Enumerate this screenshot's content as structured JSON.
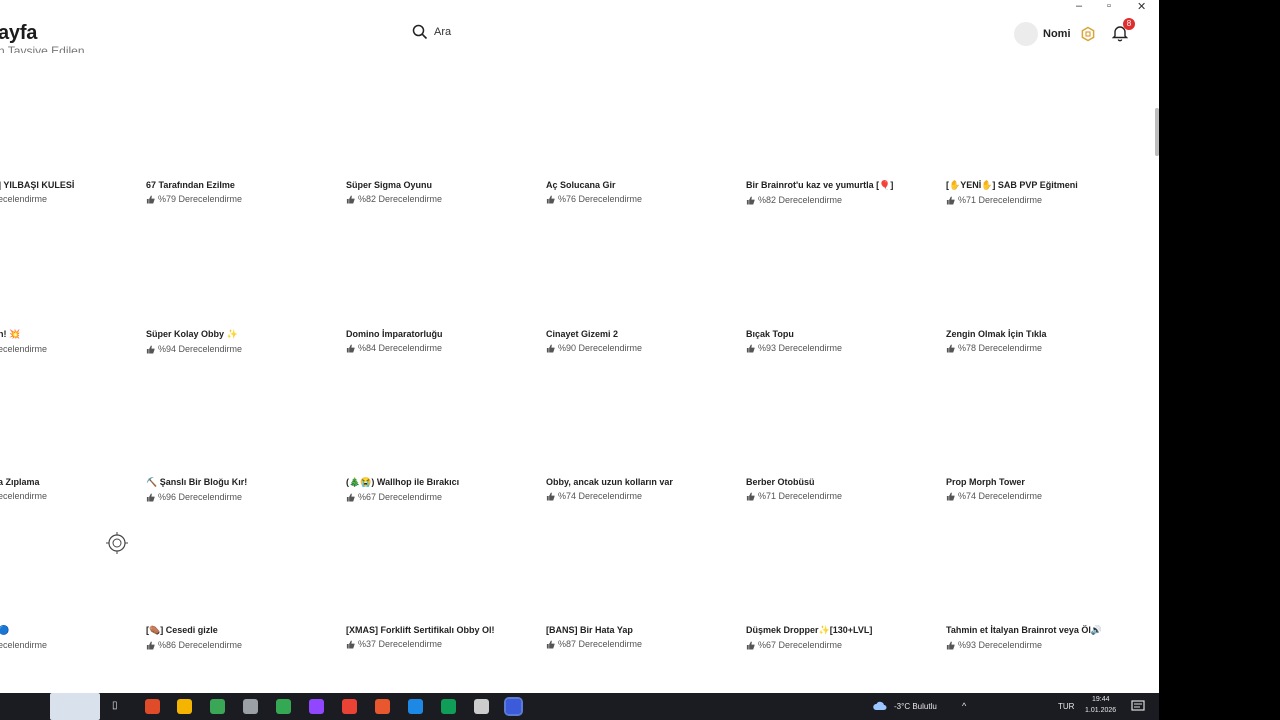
{
  "header": {
    "page_title": "ayfa",
    "subtitle_cut": "n Tavsiye Edilen",
    "search_placeholder": "Ara",
    "username": "Nomi",
    "notification_count": "8"
  },
  "window_controls": [
    "–",
    "▫",
    "✕"
  ],
  "cards": [
    {
      "title": "] YILBAŞI KULESİ",
      "rating": "ecelendirme"
    },
    {
      "title": "67 Tarafından Ezilme",
      "rating": "%79 Derecelendirme"
    },
    {
      "title": "Süper Sigma Oyunu",
      "rating": "%82 Derecelendirme"
    },
    {
      "title": "Aç Solucana Gir",
      "rating": "%76 Derecelendirme"
    },
    {
      "title": "Bir Brainrot'u kaz ve yumurtla [🎈]",
      "rating": "%82 Derecelendirme"
    },
    {
      "title": "[✋YENİ✋] SAB PVP Eğitmeni",
      "rating": "%71 Derecelendirme"
    },
    {
      "title": "n! 💥",
      "rating": "ecelendirme"
    },
    {
      "title": "Süper Kolay Obby ✨",
      "rating": "%94 Derecelendirme"
    },
    {
      "title": "Domino İmparatorluğu",
      "rating": "%84 Derecelendirme"
    },
    {
      "title": "Cinayet Gizemi 2",
      "rating": "%90 Derecelendirme"
    },
    {
      "title": "Bıçak Topu",
      "rating": "%93 Derecelendirme"
    },
    {
      "title": "Zengin Olmak İçin Tıkla",
      "rating": "%78 Derecelendirme"
    },
    {
      "title": "a Zıplama",
      "rating": "ecelendirme"
    },
    {
      "title": "⛏️ Şanslı Bir Bloğu Kır!",
      "rating": "%96 Derecelendirme"
    },
    {
      "title": "(🎄😭) Wallhop ile Bırakıcı",
      "rating": "%67 Derecelendirme"
    },
    {
      "title": "Obby, ancak uzun kolların var",
      "rating": "%74 Derecelendirme"
    },
    {
      "title": "Berber Otobüsü",
      "rating": "%71 Derecelendirme"
    },
    {
      "title": "Prop Morph Tower",
      "rating": "%74 Derecelendirme"
    },
    {
      "title": "🔵",
      "rating": "ecelendirme"
    },
    {
      "title": "[⚰️] Cesedi gizle",
      "rating": "%86 Derecelendirme"
    },
    {
      "title": "[XMAS] Forklift Sertifikalı Obby Ol!",
      "rating": "%37 Derecelendirme"
    },
    {
      "title": "[BANS] Bir Hata Yap",
      "rating": "%87 Derecelendirme"
    },
    {
      "title": "Düşmek Dropper✨[130+LVL]",
      "rating": "%67 Derecelendirme"
    },
    {
      "title": "Tahmin et İtalyan Brainrot veya Öl🔊",
      "rating": "%93 Derecelendirme"
    }
  ],
  "taskbar": {
    "weather": "-3°C  Bulutlu",
    "language": "TUR",
    "time": "19:44",
    "date": "1.01.2026",
    "app_colors": [
      "#e04b2a",
      "#f4b400",
      "#3aa757",
      "#9aa0a6",
      "#34a853",
      "#9146ff",
      "#ea4335",
      "#e8572d",
      "#1e88e5",
      "#0f9d58",
      "#cccccc",
      "#3b5bdb"
    ]
  },
  "colors": {
    "badge": "#e02e2e",
    "taskbar": "#1b1b22"
  }
}
